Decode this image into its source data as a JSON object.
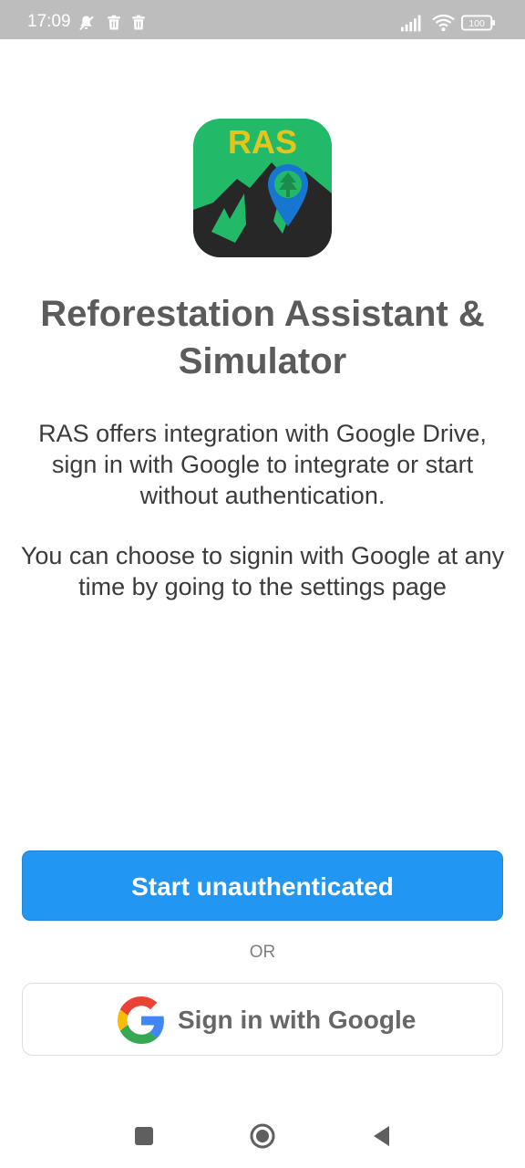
{
  "status_bar": {
    "time": "17:09",
    "battery": "100"
  },
  "app": {
    "logo_text": "RAS",
    "title": "Reforestation Assistant & Simulator",
    "description": [
      "RAS offers integration with Google Drive, sign in with Google to integrate or start without authentication.",
      "You can choose to signin with Google at any time by going to the settings page"
    ]
  },
  "actions": {
    "start_label": "Start unauthenticated",
    "or_label": "OR",
    "google_label": "Sign in with Google"
  },
  "icons": {
    "status": [
      "notification-off-icon",
      "trash-icon",
      "trash-icon",
      "signal-icon",
      "wifi-icon",
      "battery-icon"
    ],
    "navigation": [
      "recent-apps-icon",
      "home-icon",
      "back-icon"
    ]
  },
  "colors": {
    "primary": "#2196f3",
    "title": "#5b5b5b",
    "logo_green": "#22ba69",
    "logo_yellow": "#e5c51b",
    "logo_pin": "#1777d0"
  }
}
